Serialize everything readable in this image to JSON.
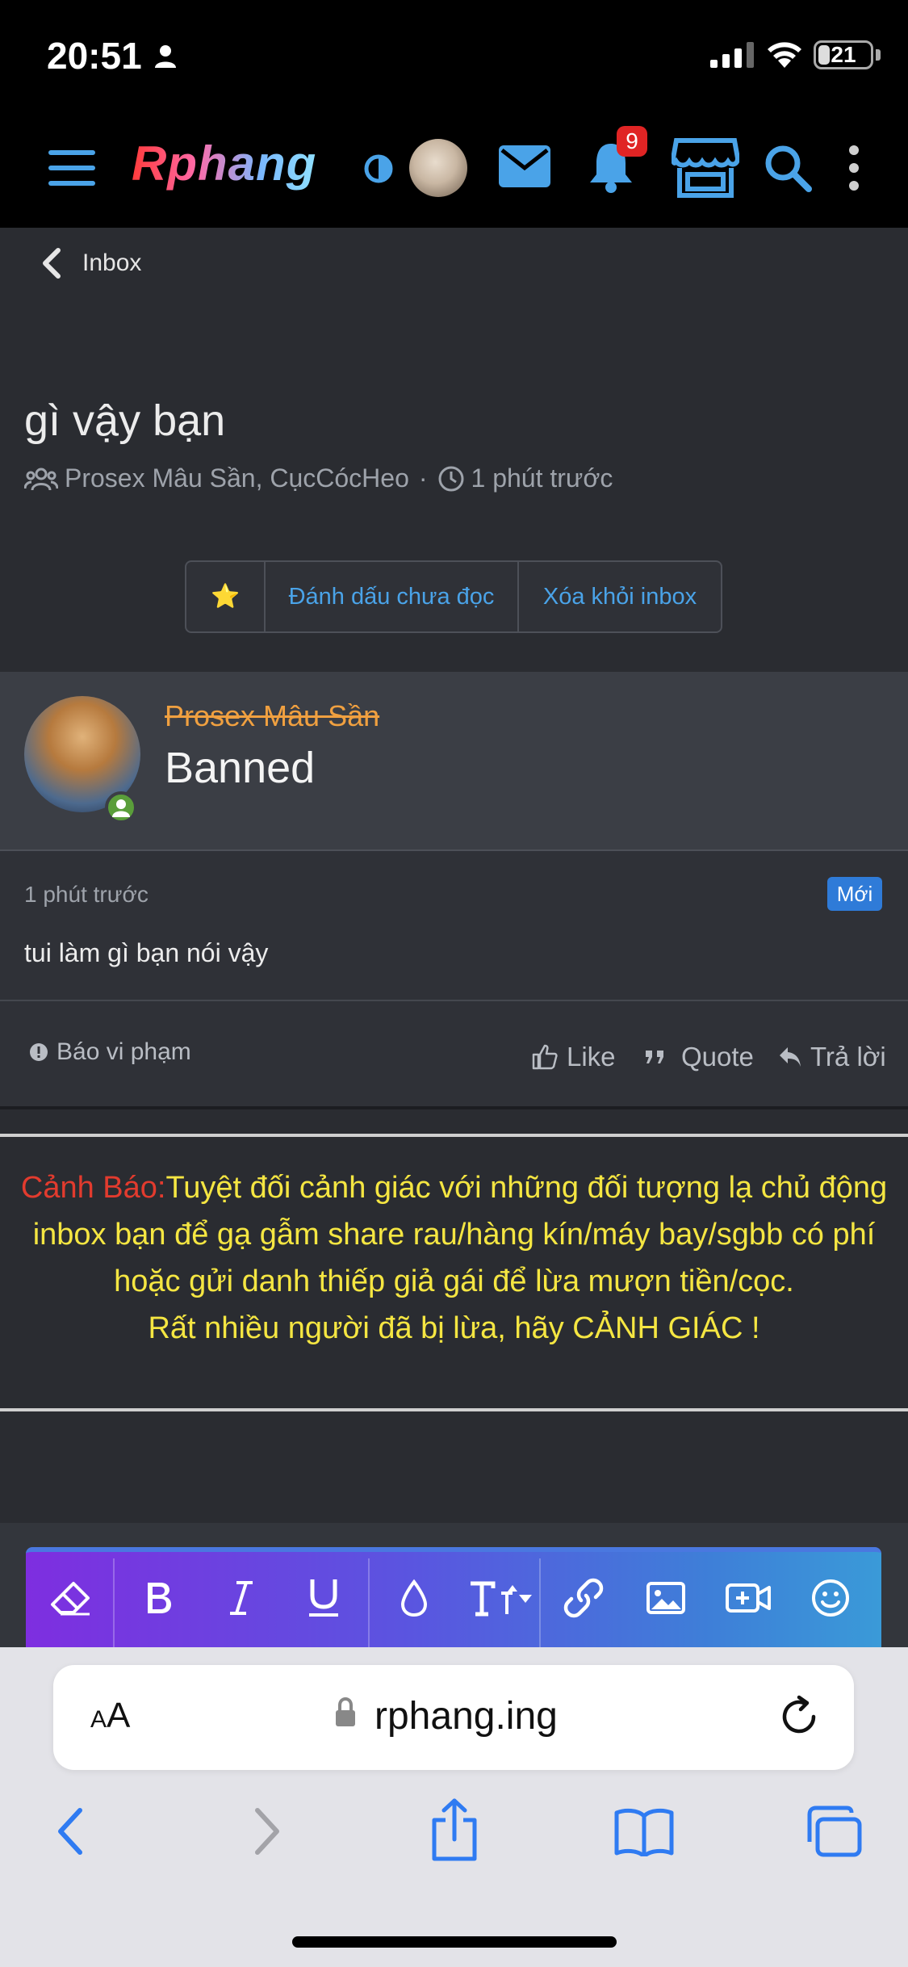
{
  "status_bar": {
    "time": "20:51",
    "battery": "21"
  },
  "header": {
    "logo": "Rphang",
    "notification_count": "9"
  },
  "breadcrumb": {
    "label": "Inbox"
  },
  "conversation": {
    "title": "gì vậy bạn",
    "participants": "Prosex Mâu Sần, CụcCócHeo",
    "separator": "·",
    "time": "1 phút trước"
  },
  "actions": {
    "star": "⭐",
    "mark_unread": "Đánh dấu chưa đọc",
    "remove_inbox": "Xóa khỏi inbox"
  },
  "message": {
    "username": "Prosex Mâu Sần",
    "role": "Banned",
    "time": "1 phút trước",
    "badge": "Mới",
    "text": "tui làm gì bạn nói vậy",
    "report": "Báo vi phạm",
    "like": "Like",
    "quote": "Quote",
    "reply": "Trả lời"
  },
  "warning": {
    "head": "Cảnh Báo:",
    "body": "Tuyệt đối cảnh giác với những đối tượng lạ chủ động inbox bạn để gạ gẫm share rau/hàng kín/máy bay/sgbb có phí hoặc gửi danh thiếp giả gái để lừa mượn tiền/cọc.",
    "footer": "Rất nhiều người đã bị lừa, hãy CẢNH GIÁC !"
  },
  "browser": {
    "aa_big": "A",
    "aa_small": "A",
    "url": "rphang.ing"
  },
  "colors": {
    "accent": "#4aa3e8",
    "banned": "#f0a040",
    "warning_head": "#e23b2e",
    "warning_text": "#f5e642",
    "new_badge": "#2f7bd8"
  }
}
